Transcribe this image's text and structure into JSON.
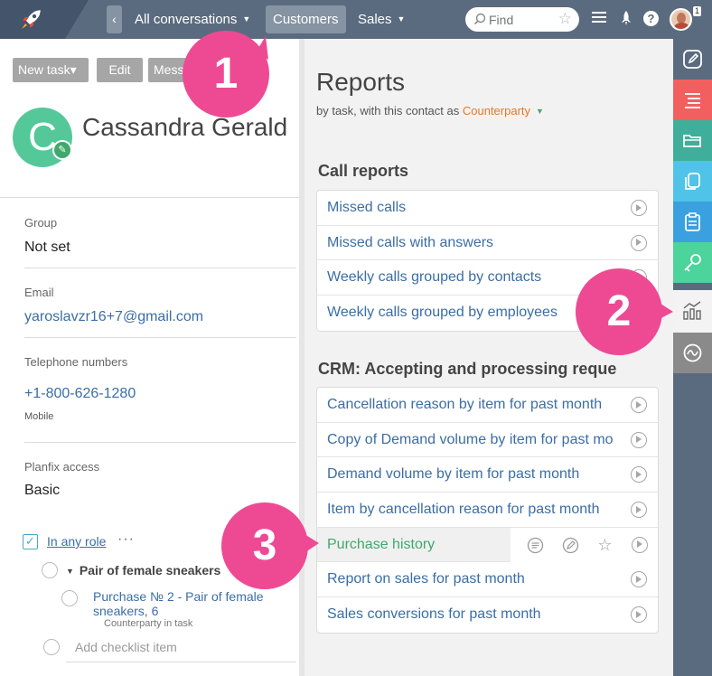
{
  "topbar": {
    "back_label": "‹",
    "nav": [
      {
        "label": "All conversations",
        "caret": "▼"
      },
      {
        "label": "Customers",
        "caret": ""
      },
      {
        "label": "Sales",
        "caret": "▼"
      }
    ],
    "search_placeholder": "Find",
    "notifications": "1",
    "icons": [
      "rocket-icon",
      "menu-icon",
      "launch-icon",
      "help-icon",
      "avatar"
    ]
  },
  "toolbar": {
    "new_task": "New task▾",
    "edit": "Edit",
    "message": "Mess"
  },
  "contact": {
    "initial": "C",
    "name": "Cassandra Gerald",
    "fields": {
      "group_label": "Group",
      "group_value": "Not set",
      "email_label": "Email",
      "email_value": "yaroslavzr16+7@gmail.com",
      "phone_label": "Telephone numbers",
      "phone_value": "+1-800-626-1280",
      "phone_type": "Mobile",
      "access_label": "Planfix access",
      "access_value": "Basic"
    }
  },
  "checklist": {
    "role": "In any role",
    "dots": "···",
    "group": "Pair of female sneakers",
    "task": "Purchase № 2 - Pair of female sneakers, 6",
    "task_sub": "Counterparty in task",
    "add_placeholder": "Add checklist item"
  },
  "reports": {
    "title": "Reports",
    "subtitle_prefix": "by task, with this contact as ",
    "subtitle_role": "Counterparty",
    "sections": [
      {
        "title": "Call reports",
        "items": [
          "Missed calls",
          "Missed calls with answers",
          "Weekly calls grouped by contacts",
          "Weekly calls grouped by employees"
        ]
      },
      {
        "title": "CRM: Accepting and processing reque",
        "items": [
          "Cancellation reason by item for past month",
          "Copy of Demand volume by item for past mo",
          "Demand volume by item for past month",
          "Item by cancellation reason for past month",
          "Purchase history",
          "Report on sales for past month",
          "Sales conversions for past month"
        ]
      }
    ]
  },
  "strip": [
    {
      "icon": "edit-icon",
      "color": "#5b6b7f"
    },
    {
      "icon": "list-icon",
      "color": "#f25f5f"
    },
    {
      "icon": "folder-icon",
      "color": "#3fae9a"
    },
    {
      "icon": "documents-icon",
      "color": "#4fc3e8"
    },
    {
      "icon": "clipboard-icon",
      "color": "#3aa0e0"
    },
    {
      "icon": "key-icon",
      "color": "#4dd39c"
    },
    {
      "icon": "analytics-icon",
      "color": "#f3f3f3"
    },
    {
      "icon": "wave-icon",
      "color": "#8a8a8a"
    }
  ],
  "callouts": [
    "1",
    "2",
    "3"
  ]
}
